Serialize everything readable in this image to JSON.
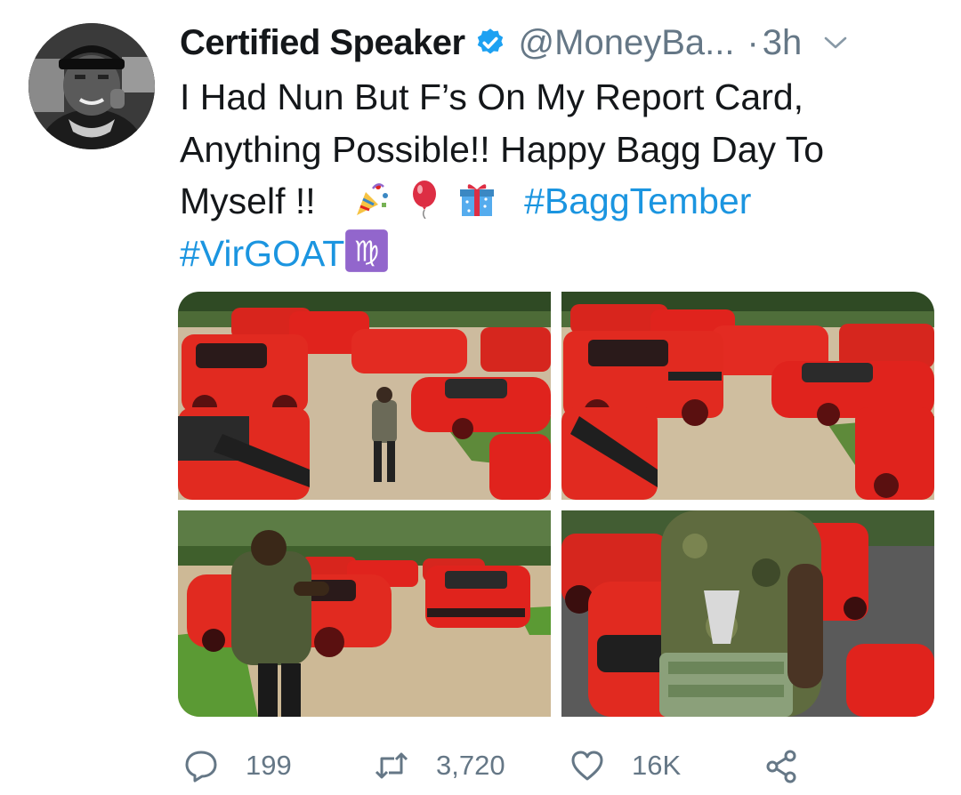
{
  "tweet": {
    "author_name": "Certified Speaker",
    "handle": "@MoneyBa...",
    "separator": "·",
    "time": "3h",
    "text_lines": [
      "I Had Nun But F’s On My Report Card,",
      "Anything Possible!! Happy Bagg Day To",
      "Myself !!"
    ],
    "hashtags": [
      "#BaggTember",
      "#VirGOAT"
    ],
    "emojis": [
      "party-popper",
      "red-balloon",
      "wrapped-gift",
      "virgo-sign"
    ]
  },
  "actions": {
    "replies": "199",
    "retweets": "3,720",
    "likes": "16K"
  },
  "colors": {
    "link": "#1b95e0",
    "secondary_text": "#657786",
    "verified": "#1da1f2",
    "car_red": "#e0231d"
  },
  "icons": [
    "verified-badge-icon",
    "chevron-down-icon",
    "reply-icon",
    "retweet-icon",
    "like-icon",
    "share-icon"
  ]
}
